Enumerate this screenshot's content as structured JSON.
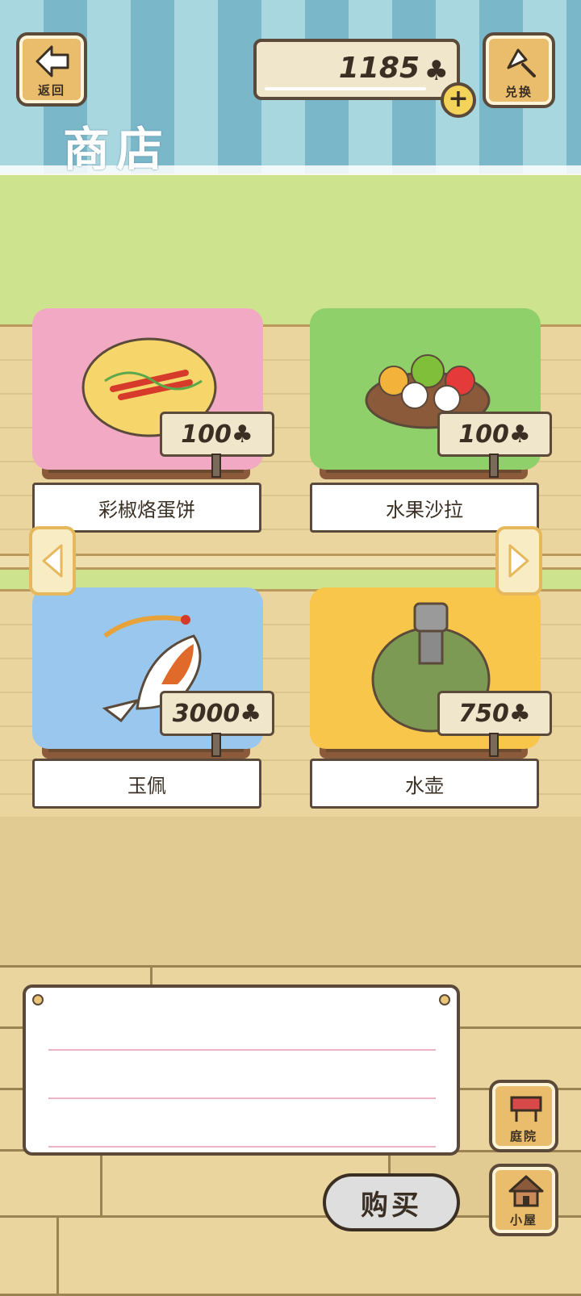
{
  "header": {
    "back_label": "返回",
    "title": "商店",
    "clover_count": "1185",
    "clover_icon": "clover-icon",
    "exchange_label": "兑换"
  },
  "items": [
    {
      "name": "彩椒烙蛋饼",
      "price": "100",
      "cloth_color": "#f2a9c3",
      "icon": "pancake-icon"
    },
    {
      "name": "水果沙拉",
      "price": "100",
      "cloth_color": "#8fd06a",
      "icon": "fruit-salad-icon"
    },
    {
      "name": "玉佩",
      "price": "3000",
      "cloth_color": "#9ac7ee",
      "icon": "koi-jade-icon"
    },
    {
      "name": "水壶",
      "price": "750",
      "cloth_color": "#f7c64a",
      "icon": "canteen-icon"
    }
  ],
  "footer": {
    "buy_label": "购买",
    "yard_label": "庭院",
    "house_label": "小屋"
  },
  "colors": {
    "awning_light": "#a9d7df",
    "awning_dark": "#79b7c9",
    "wall": "#cde38e",
    "wood": "#ead59f",
    "outline": "#5b4a3a"
  }
}
